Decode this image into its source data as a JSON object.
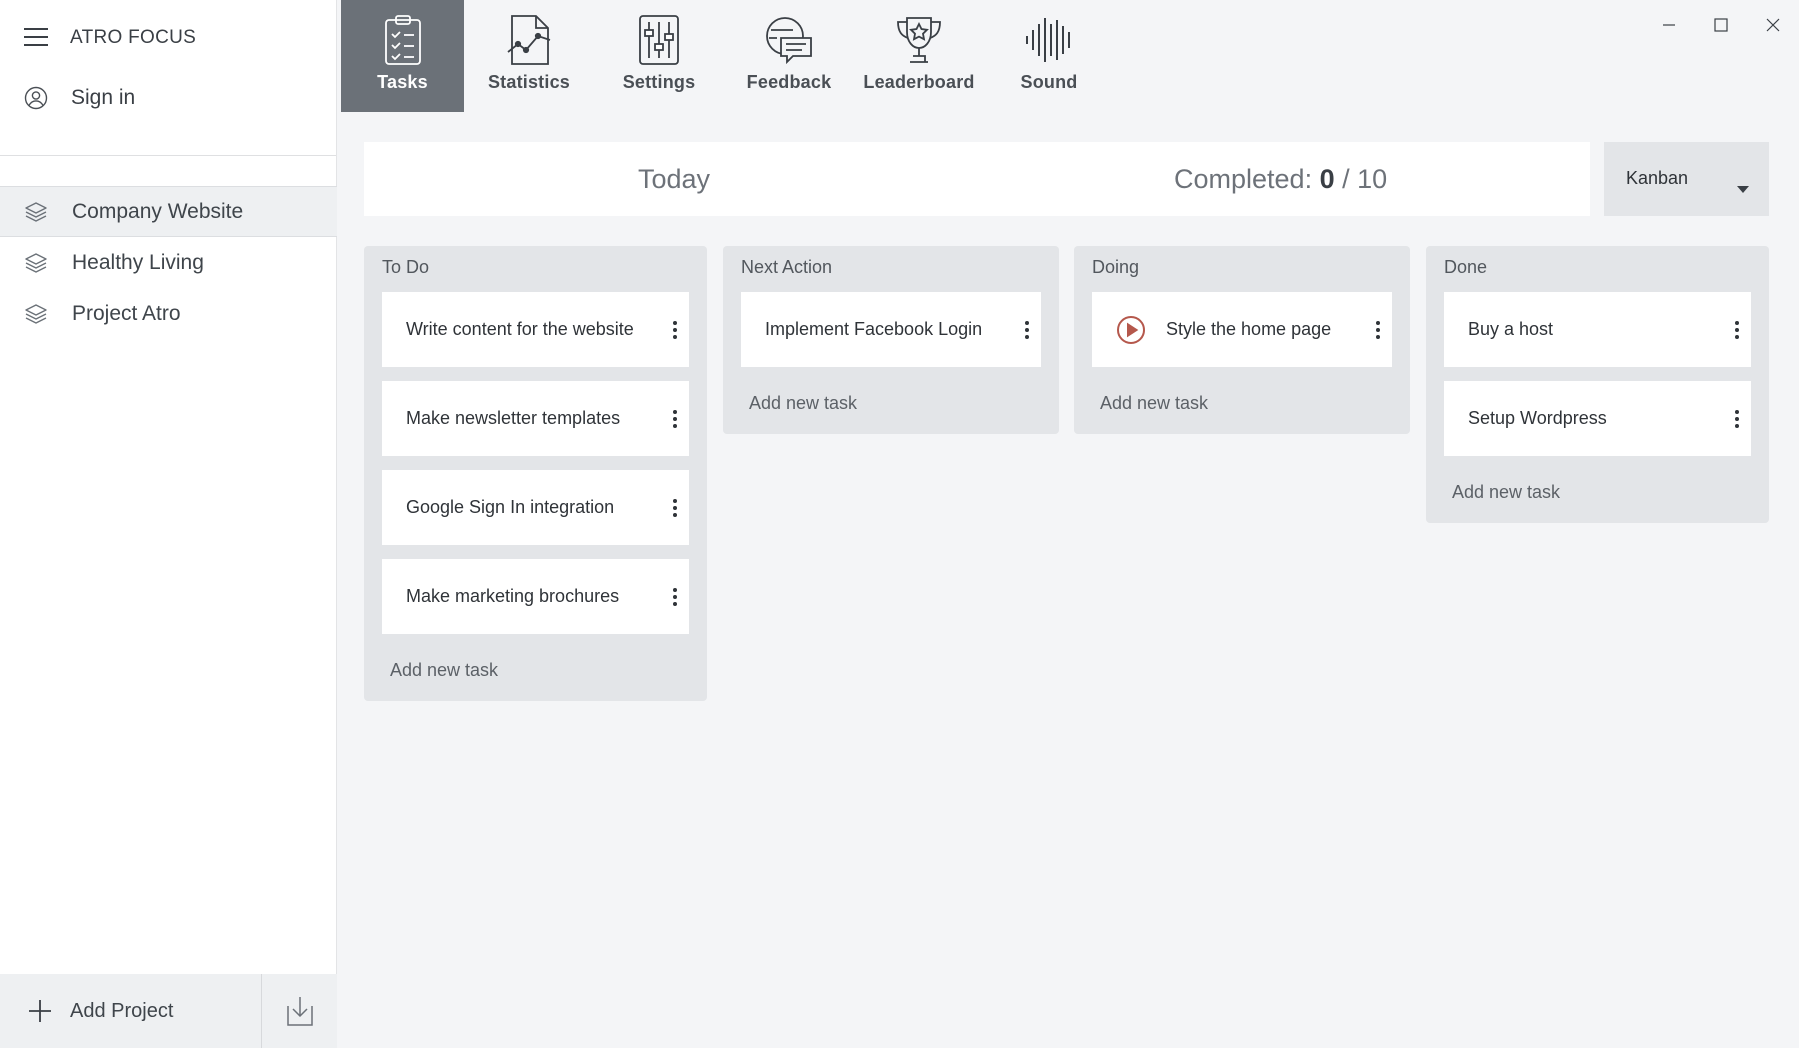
{
  "app": {
    "title": "ATRO FOCUS"
  },
  "sidebar": {
    "menu_icon": "hamburger-menu-icon",
    "sign_in": "Sign in",
    "projects": [
      {
        "label": "Company Website",
        "active": true
      },
      {
        "label": "Healthy Living",
        "active": false
      },
      {
        "label": "Project Atro",
        "active": false
      }
    ],
    "add_project": "Add Project"
  },
  "toolbar": {
    "items": [
      {
        "label": "Tasks",
        "icon": "clipboard-checklist-icon",
        "active": true
      },
      {
        "label": "Statistics",
        "icon": "chart-document-icon",
        "active": false
      },
      {
        "label": "Settings",
        "icon": "sliders-icon",
        "active": false
      },
      {
        "label": "Feedback",
        "icon": "speech-bubbles-icon",
        "active": false
      },
      {
        "label": "Leaderboard",
        "icon": "trophy-icon",
        "active": false
      },
      {
        "label": "Sound",
        "icon": "sound-wave-icon",
        "active": false
      }
    ]
  },
  "summary": {
    "today": "Today",
    "completed_label": "Completed:",
    "completed_count": "0",
    "completed_sep": " / ",
    "completed_total": "10"
  },
  "view_select": {
    "selected": "Kanban"
  },
  "columns": [
    {
      "title": "To Do",
      "cards": [
        "Write content for the website",
        "Make newsletter templates",
        "Google Sign In integration",
        "Make marketing brochures"
      ],
      "add": "Add new task"
    },
    {
      "title": "Next Action",
      "cards": [
        "Implement Facebook Login"
      ],
      "add": "Add new task"
    },
    {
      "title": "Doing",
      "cards": [
        "Style the home page"
      ],
      "add": "Add new task"
    },
    {
      "title": "Done",
      "cards": [
        "Buy a host",
        "Setup Wordpress"
      ],
      "add": "Add new task"
    }
  ],
  "colors": {
    "active_tab": "#6b7178",
    "play_icon": "#b5584c",
    "background": "#f4f5f7"
  }
}
